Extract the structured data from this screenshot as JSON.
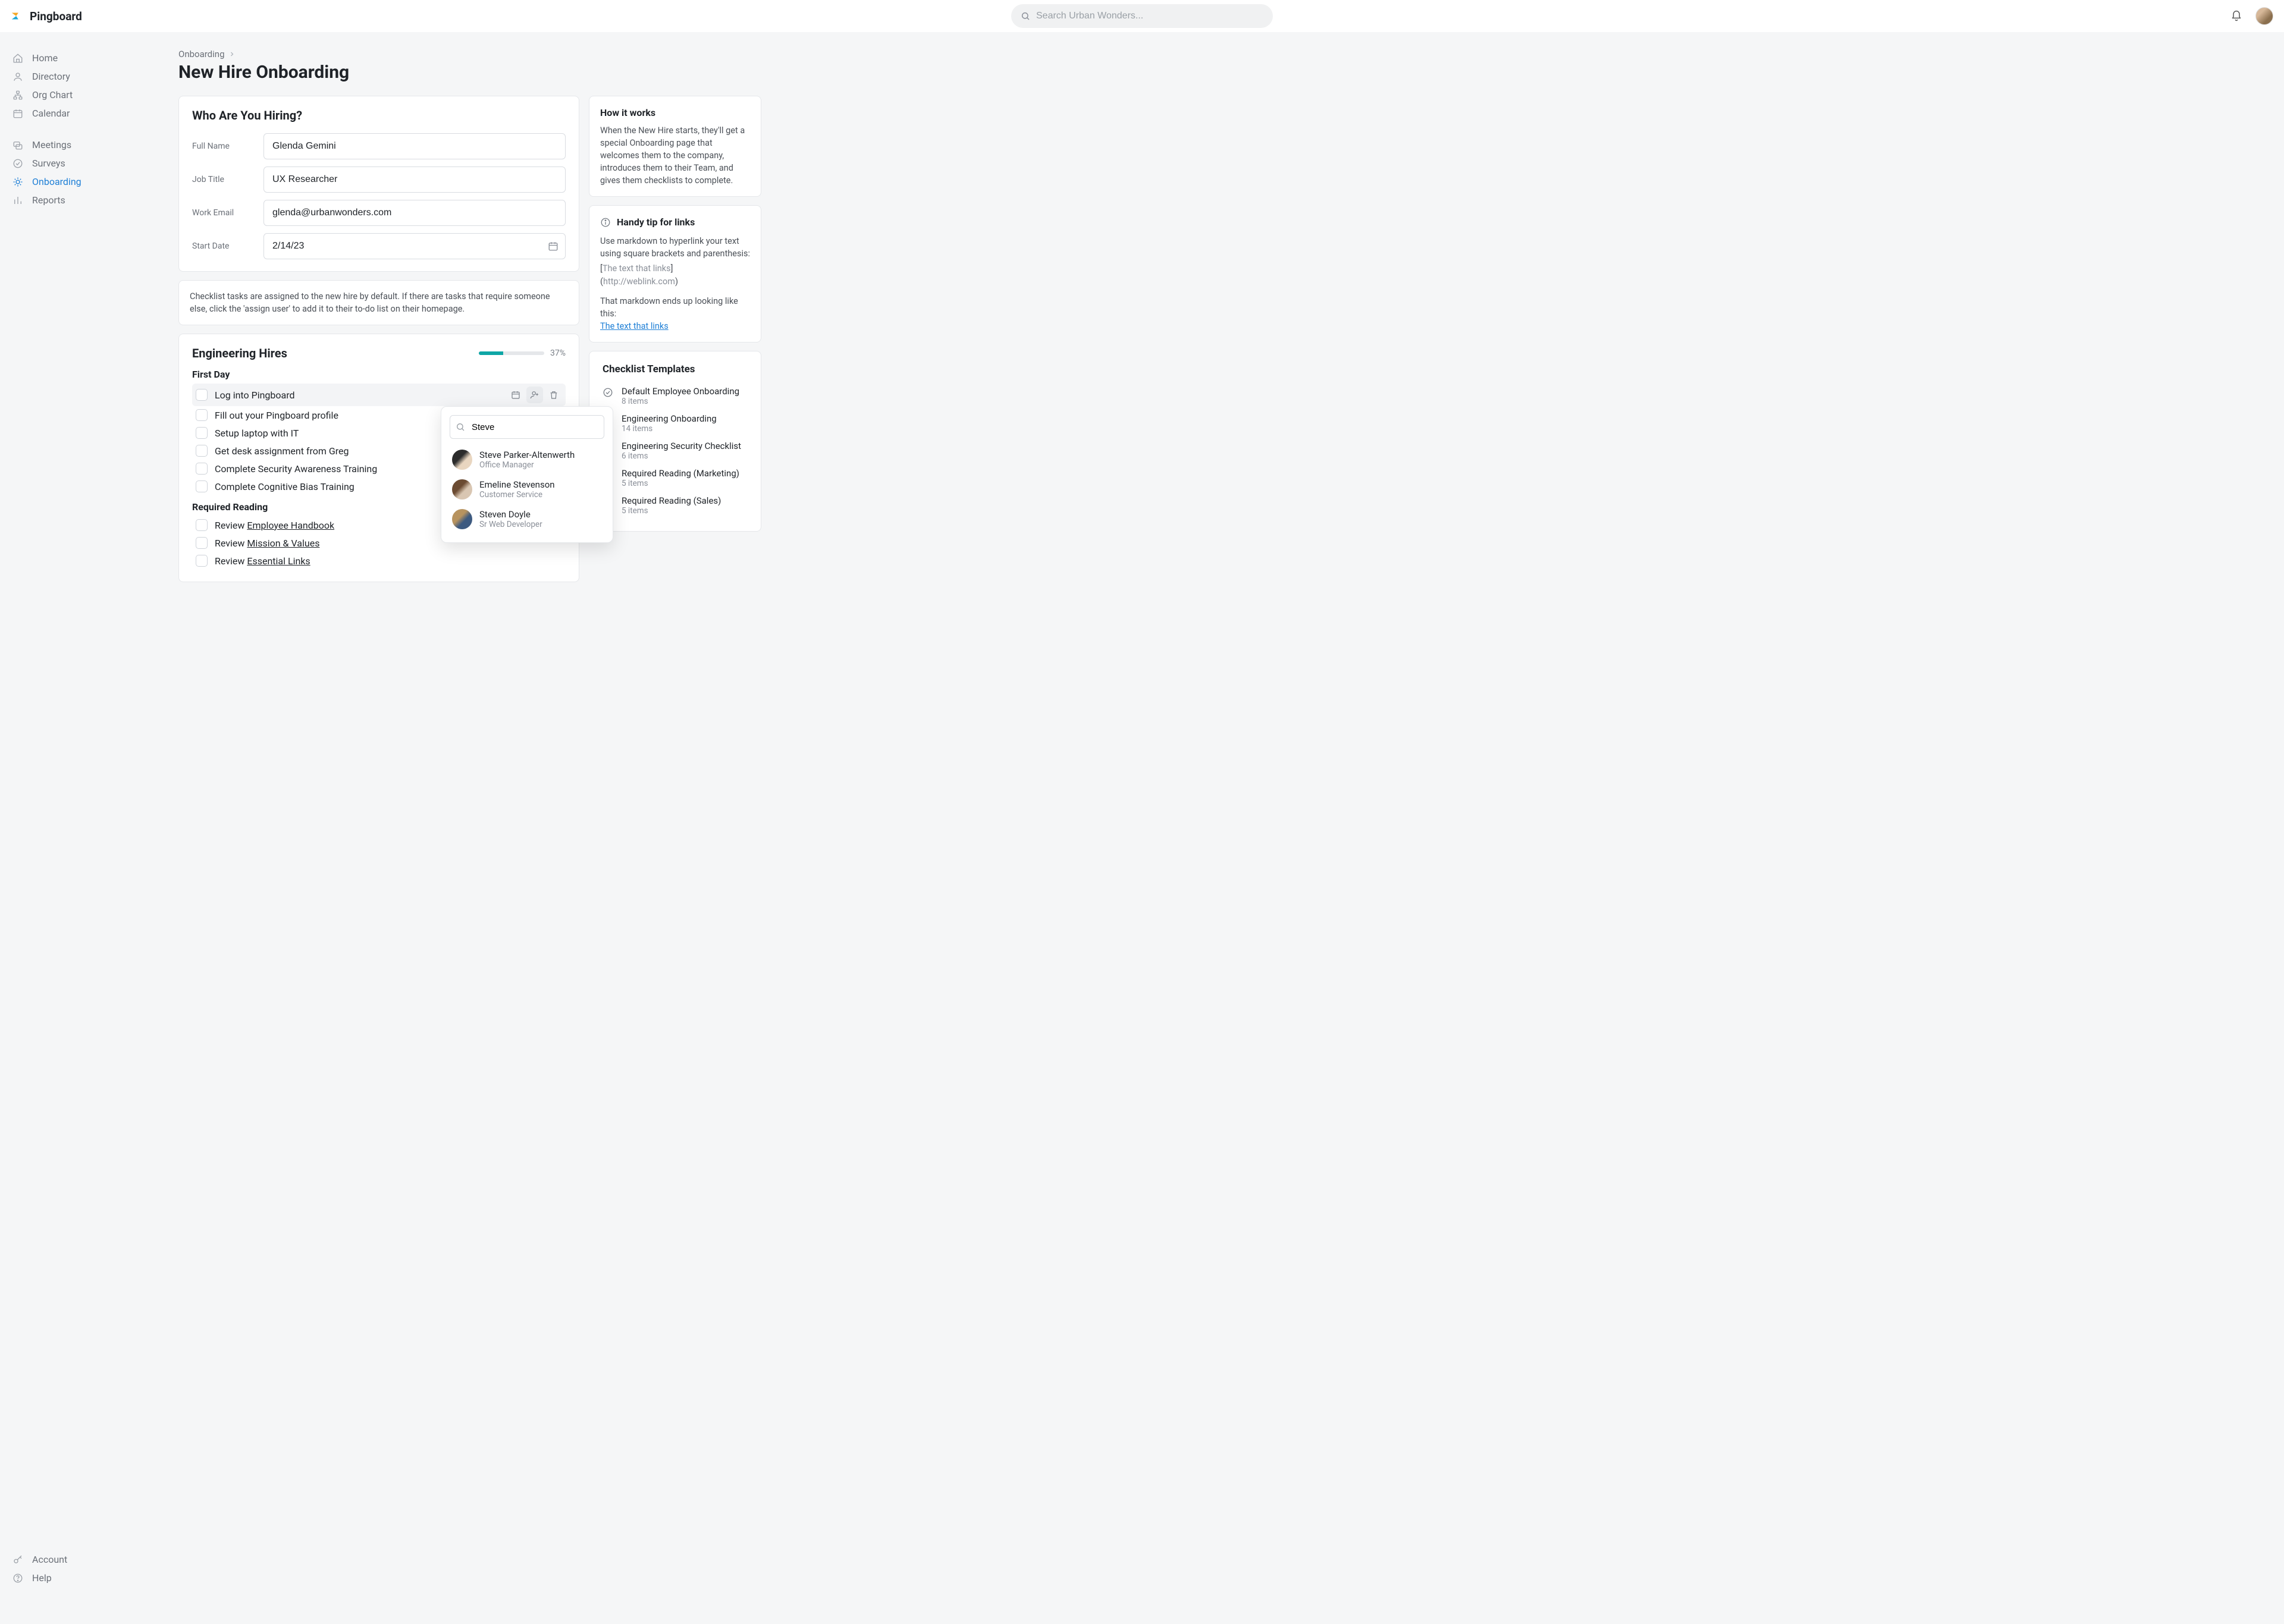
{
  "brand": "Pingboard",
  "search": {
    "placeholder": "Search Urban Wonders..."
  },
  "nav": {
    "primary": [
      {
        "label": "Home"
      },
      {
        "label": "Directory"
      },
      {
        "label": "Org Chart"
      },
      {
        "label": "Calendar"
      }
    ],
    "secondary": [
      {
        "label": "Meetings"
      },
      {
        "label": "Surveys"
      },
      {
        "label": "Onboarding"
      },
      {
        "label": "Reports"
      }
    ],
    "bottom": [
      {
        "label": "Account"
      },
      {
        "label": "Help"
      }
    ]
  },
  "breadcrumb": {
    "parent": "Onboarding"
  },
  "page_title": "New Hire Onboarding",
  "hiring": {
    "heading": "Who Are You Hiring?",
    "fields": {
      "full_name": {
        "label": "Full Name",
        "value": "Glenda Gemini"
      },
      "job_title": {
        "label": "Job Title",
        "value": "UX Researcher"
      },
      "work_email": {
        "label": "Work Email",
        "value": "glenda@urbanwonders.com"
      },
      "start_date": {
        "label": "Start Date",
        "value": "2/14/23"
      }
    }
  },
  "assign_note": "Checklist tasks are assigned to the new hire by default. If there are tasks that require someone else, click the 'assign user' to add it to their to-do list on their homepage.",
  "how_it_works": {
    "title": "How it works",
    "body": "When the New Hire starts, they'll get a special Onboarding page that welcomes them to the company, introduces them to their Team, and gives them checklists to complete."
  },
  "tip": {
    "title": "Handy tip for links",
    "body1": "Use markdown to hyperlink your text using square brackets and parenthesis:",
    "example_prefix": "[",
    "example_text": "The text that links",
    "example_mid": "](",
    "example_url": "http://weblink.com",
    "example_suffix": ")",
    "body2": "That markdown ends up looking like this:",
    "link_text": "The text that links"
  },
  "checklist": {
    "title": "Engineering Hires",
    "progress_pct": "37%",
    "progress_value": 37,
    "sections": [
      {
        "label": "First Day",
        "tasks": [
          {
            "text": "Log into Pingboard",
            "hovered": true
          },
          {
            "text": "Fill out your Pingboard profile"
          },
          {
            "text": "Setup laptop with IT"
          },
          {
            "text": "Get desk assignment from Greg"
          },
          {
            "text": "Complete Security Awareness Training"
          },
          {
            "text": "Complete Cognitive Bias Training"
          }
        ]
      },
      {
        "label": "Required Reading",
        "tasks": [
          {
            "prefix": "Review ",
            "link": "Employee Handbook"
          },
          {
            "prefix": "Review ",
            "link": "Mission & Values"
          },
          {
            "prefix": "Review ",
            "link": "Essential Links"
          }
        ]
      }
    ]
  },
  "assign_popover": {
    "query": "Steve",
    "results": [
      {
        "name": "Steve Parker-Altenwerth",
        "title": "Office Manager"
      },
      {
        "name": "Emeline Stevenson",
        "title": "Customer Service"
      },
      {
        "name": "Steven Doyle",
        "title": "Sr Web Developer"
      }
    ]
  },
  "templates": {
    "title": "Checklist Templates",
    "items": [
      {
        "name": "Default Employee Onboarding",
        "count": "8 items"
      },
      {
        "name": "Engineering Onboarding",
        "count": "14 items"
      },
      {
        "name": "Engineering Security Checklist",
        "count": "6 items"
      },
      {
        "name": "Required Reading (Marketing)",
        "count": "5 items"
      },
      {
        "name": "Required Reading (Sales)",
        "count": "5 items"
      }
    ]
  }
}
